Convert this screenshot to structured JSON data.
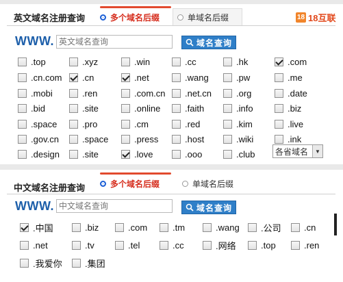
{
  "english_section": {
    "title": "英文域名注册查询",
    "tab_multi": "多个域名后缀",
    "tab_single": "单域名后缀",
    "logo_badge": "18",
    "logo_text": "18互联",
    "www_label": "WWW.",
    "search_placeholder": "英文域名查询",
    "search_button": "域名查询",
    "suffixes": [
      {
        "label": ".top",
        "checked": false
      },
      {
        "label": ".xyz",
        "checked": false
      },
      {
        "label": ".win",
        "checked": false
      },
      {
        "label": ".cc",
        "checked": false
      },
      {
        "label": ".hk",
        "checked": false
      },
      {
        "label": ".com",
        "checked": true
      },
      {
        "label": ".cn.com",
        "checked": false
      },
      {
        "label": ".cn",
        "checked": true
      },
      {
        "label": ".net",
        "checked": true
      },
      {
        "label": ".wang",
        "checked": false
      },
      {
        "label": ".pw",
        "checked": false
      },
      {
        "label": ".me",
        "checked": false
      },
      {
        "label": ".mobi",
        "checked": false
      },
      {
        "label": ".ren",
        "checked": false
      },
      {
        "label": ".com.cn",
        "checked": false
      },
      {
        "label": ".net.cn",
        "checked": false
      },
      {
        "label": ".org",
        "checked": false
      },
      {
        "label": ".date",
        "checked": false
      },
      {
        "label": ".bid",
        "checked": false
      },
      {
        "label": ".site",
        "checked": false
      },
      {
        "label": ".online",
        "checked": false
      },
      {
        "label": ".faith",
        "checked": false
      },
      {
        "label": ".info",
        "checked": false
      },
      {
        "label": ".biz",
        "checked": false
      },
      {
        "label": ".space",
        "checked": false
      },
      {
        "label": ".pro",
        "checked": false
      },
      {
        "label": ".cm",
        "checked": false
      },
      {
        "label": ".red",
        "checked": false
      },
      {
        "label": ".kim",
        "checked": false
      },
      {
        "label": ".live",
        "checked": false
      },
      {
        "label": ".gov.cn",
        "checked": false
      },
      {
        "label": ".space",
        "checked": false
      },
      {
        "label": ".press",
        "checked": false
      },
      {
        "label": ".host",
        "checked": false
      },
      {
        "label": ".wiki",
        "checked": false
      },
      {
        "label": ".ink",
        "checked": false
      },
      {
        "label": ".design",
        "checked": false
      },
      {
        "label": ".site",
        "checked": false
      },
      {
        "label": ".love",
        "checked": true
      },
      {
        "label": ".ooo",
        "checked": false
      },
      {
        "label": ".club",
        "checked": false
      }
    ],
    "province_select": "各省域名"
  },
  "chinese_section": {
    "title": "中文域名注册查询",
    "tab_multi": "多个域名后缀",
    "tab_single": "单域名后缀",
    "www_label": "WWW.",
    "search_placeholder": "中文域名查询",
    "search_button": "域名查询",
    "suffixes": [
      {
        "label": ".中国",
        "checked": true
      },
      {
        "label": ".biz",
        "checked": false
      },
      {
        "label": ".com",
        "checked": false
      },
      {
        "label": ".tm",
        "checked": false
      },
      {
        "label": ".wang",
        "checked": false
      },
      {
        "label": ".公司",
        "checked": false
      },
      {
        "label": ".cn",
        "checked": false
      },
      {
        "label": ".net",
        "checked": false
      },
      {
        "label": ".tv",
        "checked": false
      },
      {
        "label": ".tel",
        "checked": false
      },
      {
        "label": ".cc",
        "checked": false
      },
      {
        "label": ".网络",
        "checked": false
      },
      {
        "label": ".top",
        "checked": false
      },
      {
        "label": ".ren",
        "checked": false
      },
      {
        "label": ".我爱你",
        "checked": false
      },
      {
        "label": ".集团",
        "checked": false
      }
    ]
  },
  "colors": {
    "accent_red": "#d62e1e",
    "www_blue": "#1d5faa",
    "button_blue": "#2f7fc8",
    "logo_orange": "#e2471a"
  }
}
